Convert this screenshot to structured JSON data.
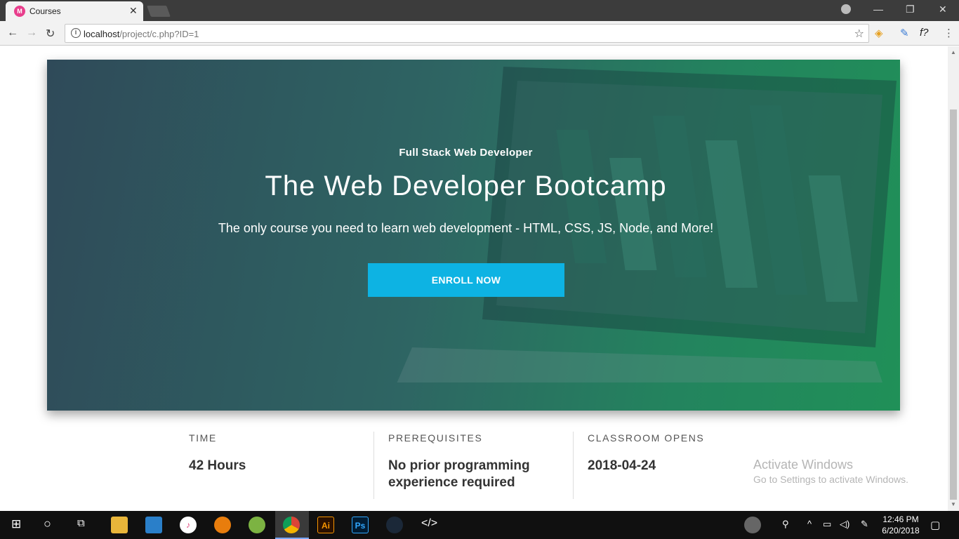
{
  "browser": {
    "tab_title": "Courses",
    "tab_close": "✕",
    "url_host": "localhost",
    "url_path": "/project/c.php?ID=1",
    "info_glyph": "i",
    "back_glyph": "←",
    "forward_glyph": "→",
    "reload_glyph": "↻",
    "star_glyph": "☆",
    "ext_formula": "f?",
    "minimize_glyph": "—",
    "restore_glyph": "❐",
    "close_glyph": "✕"
  },
  "hero": {
    "subtitle": "Full Stack Web Developer",
    "title": "The Web Developer Bootcamp",
    "description": "The only course you need to learn web development - HTML, CSS, JS, Node, and More!",
    "button_label": "ENROLL NOW"
  },
  "details": [
    {
      "label": "TIME",
      "value": "42 Hours"
    },
    {
      "label": "PREREQUISITES",
      "value": "No prior programming experience required"
    },
    {
      "label": "CLASSROOM OPENS",
      "value": "2018-04-24"
    }
  ],
  "watermark": {
    "line1": "Activate Windows",
    "line2": "Go to Settings to activate Windows."
  },
  "taskbar": {
    "time": "12:46 PM",
    "date": "6/20/2018",
    "illustrator_label": "Ai",
    "photoshop_label": "Ps"
  },
  "colors": {
    "enroll_button": "#0db3e3",
    "hero_gradient_start": "#2f4a59",
    "hero_gradient_end": "#209058"
  }
}
